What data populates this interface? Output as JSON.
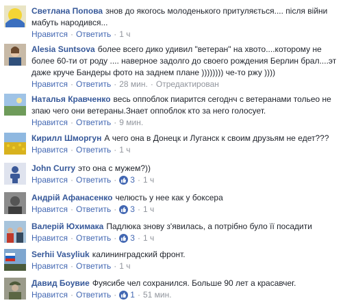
{
  "ui": {
    "like": "Нравится",
    "reply": "Ответить",
    "dot": "·",
    "colors": {
      "link": "#4267b2",
      "author": "#365899",
      "meta": "#90949c"
    }
  },
  "comments": [
    {
      "author": "Светлана Попова",
      "text": "знов до якогось молоденького притуляється.... після війни мабуть народився...",
      "likes": "",
      "time": "1 ч",
      "extra": "",
      "avatar": "yellow-blue-flag"
    },
    {
      "author": "Alesia Suntsova",
      "text": "более всего дико удивил \"ветеран\" на хвото....которому не более 60-ти от роду .... наверное задолго до своего рождения Берлин брал....эт даже круче Бандеры фото на заднем плане )))))))) че-то ржу ))))",
      "likes": "",
      "time": "28 мин.",
      "extra": "Отредактирован",
      "avatar": "person-photo"
    },
    {
      "author": "Наталья Кравченко",
      "text": "весь оппоблок пиарится сегоднч с ветеранами тольео не зпаю чего они ветераны.Знает оппоблок кто за него голосует.",
      "likes": "",
      "time": "9 мин.",
      "extra": "",
      "avatar": "landscape-photo"
    },
    {
      "author": "Кирилл Шморгун",
      "text": "А чего она в Донецк и Луганск к своим друзьям не едет???",
      "likes": "",
      "time": "1 ч",
      "extra": "",
      "avatar": "sunflower-field"
    },
    {
      "author": "John Curry",
      "text": "это она с мужем?))",
      "likes": "3",
      "time": "1 ч",
      "extra": "",
      "avatar": "default-silhouette"
    },
    {
      "author": "Андрій Афанасенко",
      "text": "челюсть у нее как у боксера",
      "likes": "3",
      "time": "1 ч",
      "extra": "",
      "avatar": "grey-photo"
    },
    {
      "author": "Валерій Юхимака",
      "text": "Падлюка знову з'явилась, а потрібно було її посадити",
      "likes": "3",
      "time": "1 ч",
      "extra": "",
      "avatar": "group-photo"
    },
    {
      "author": "Serhii Vasyliuk",
      "text": "калининградский фронт.",
      "likes": "",
      "time": "1 ч",
      "extra": "",
      "avatar": "flags-photo"
    },
    {
      "author": "Давид Боувие",
      "text": "Фуясибе чел сохранился. Больше 90 лет а красавчег.",
      "likes": "1",
      "time": "51 мин.",
      "extra": "",
      "avatar": "soldier-photo"
    }
  ]
}
